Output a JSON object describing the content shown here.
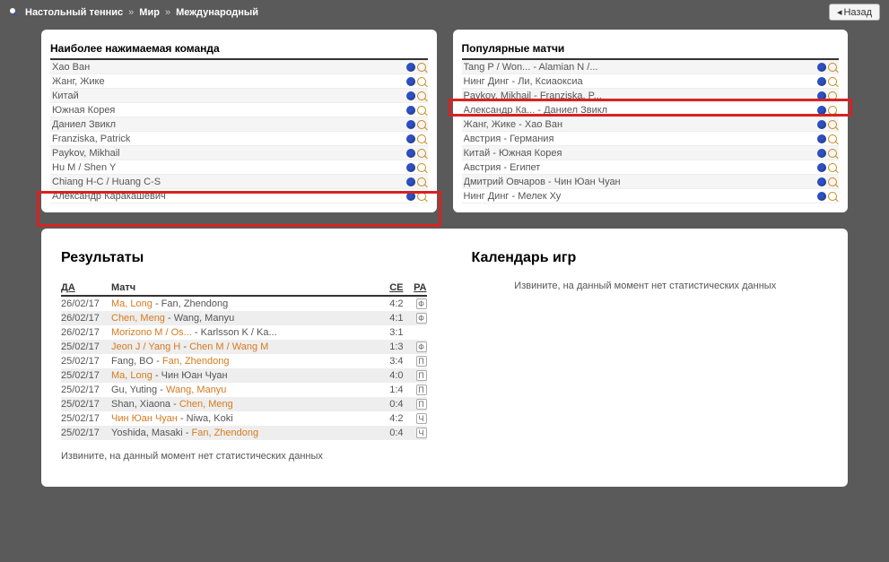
{
  "breadcrumb": {
    "sport": "Настольный теннис",
    "region": "Мир",
    "league": "Международный"
  },
  "back_label": "Назад",
  "teams_panel": {
    "title": "Наиболее нажимаемая команда",
    "items": [
      "Хао Ван",
      "Жанг, Жике",
      "Китай",
      "Южная Корея",
      "Даниел Звикл",
      "Franziska, Patrick",
      "Paykov, Mikhail",
      "Hu M / Shen Y",
      "Chiang H-C / Huang C-S",
      "Александр Каракашевич"
    ]
  },
  "matches_panel": {
    "title": "Популярные матчи",
    "items": [
      "Tang P / Won... - Alamian N /...",
      "Нинг Динг - Ли, Ксиаоксиа",
      "Paykov, Mikhail - Franziska, P...",
      "Александр Ка... - Даниел Звикл",
      "Жанг, Жике - Хао Ван",
      "Австрия - Германия",
      "Китай - Южная Корея",
      "Австрия - Египет",
      "Дмитрий Овчаров - Чин Юан Чуан",
      "Нинг Динг - Мелек Ху"
    ]
  },
  "results": {
    "title": "Результаты",
    "head": {
      "date": "ДА",
      "match": "Матч",
      "score": "СЕ",
      "pa": "РА"
    },
    "rows": [
      {
        "date": "26/02/17",
        "home": "Ma, Long",
        "away": "Fan, Zhendong",
        "home_link": true,
        "away_link": false,
        "score": "4:2",
        "pa": "Ф"
      },
      {
        "date": "26/02/17",
        "home": "Chen, Meng",
        "away": "Wang, Manyu",
        "home_link": true,
        "away_link": false,
        "score": "4:1",
        "pa": "Ф"
      },
      {
        "date": "26/02/17",
        "home": "Morizono M / Os...",
        "away": "Karlsson K / Ka...",
        "home_link": true,
        "away_link": false,
        "score": "3:1",
        "pa": ""
      },
      {
        "date": "25/02/17",
        "home": "Jeon J / Yang H",
        "away": "Chen M / Wang M",
        "home_link": true,
        "away_link": true,
        "score": "1:3",
        "pa": "Ф"
      },
      {
        "date": "25/02/17",
        "home": "Fang, BO",
        "away": "Fan, Zhendong",
        "home_link": false,
        "away_link": true,
        "score": "3:4",
        "pa": "П"
      },
      {
        "date": "25/02/17",
        "home": "Ma, Long",
        "away": "Чин Юан Чуан",
        "home_link": true,
        "away_link": false,
        "score": "4:0",
        "pa": "П"
      },
      {
        "date": "25/02/17",
        "home": "Gu, Yuting",
        "away": "Wang, Manyu",
        "home_link": false,
        "away_link": true,
        "score": "1:4",
        "pa": "П"
      },
      {
        "date": "25/02/17",
        "home": "Shan, Xiaona",
        "away": "Chen, Meng",
        "home_link": false,
        "away_link": true,
        "score": "0:4",
        "pa": "П"
      },
      {
        "date": "25/02/17",
        "home": "Чин Юан Чуан",
        "away": "Niwa, Koki",
        "home_link": true,
        "away_link": false,
        "score": "4:2",
        "pa": "Ч"
      },
      {
        "date": "25/02/17",
        "home": "Yoshida, Masaki",
        "away": "Fan, Zhendong",
        "home_link": false,
        "away_link": true,
        "score": "0:4",
        "pa": "Ч"
      }
    ],
    "no_data": "Извините, на данный момент нет статистических данных"
  },
  "calendar": {
    "title": "Календарь игр",
    "no_data": "Извините, на данный момент нет статистических данных"
  }
}
